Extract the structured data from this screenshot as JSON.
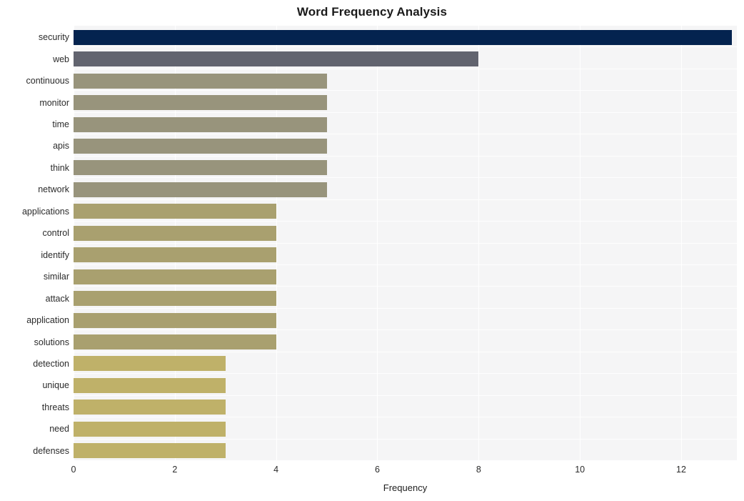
{
  "chart_data": {
    "type": "bar",
    "orientation": "horizontal",
    "title": "Word Frequency Analysis",
    "xlabel": "Frequency",
    "ylabel": "",
    "categories": [
      "security",
      "web",
      "continuous",
      "monitor",
      "time",
      "apis",
      "think",
      "network",
      "applications",
      "control",
      "identify",
      "similar",
      "attack",
      "application",
      "solutions",
      "detection",
      "unique",
      "threats",
      "need",
      "defenses"
    ],
    "values": [
      13,
      8,
      5,
      5,
      5,
      5,
      5,
      5,
      4,
      4,
      4,
      4,
      4,
      4,
      4,
      3,
      3,
      3,
      3,
      3
    ],
    "bar_colors": [
      "#04234f",
      "#62646f",
      "#98947c",
      "#98947c",
      "#98947c",
      "#98947c",
      "#98947c",
      "#98947c",
      "#a9a06f",
      "#a9a06f",
      "#a9a06f",
      "#a9a06f",
      "#a9a06f",
      "#a9a06f",
      "#a9a06f",
      "#bfb169",
      "#bfb169",
      "#bfb169",
      "#bfb169",
      "#bfb169"
    ],
    "xticks": [
      0,
      2,
      4,
      6,
      8,
      10,
      12
    ],
    "xtick_labels": [
      "0",
      "2",
      "4",
      "6",
      "8",
      "10",
      "12"
    ],
    "xlim": [
      0,
      13.1
    ],
    "grid": true,
    "legend": false,
    "plot_background": "#f5f5f6",
    "gridline_color": "#ffffff",
    "title_color": "#1a1a1a",
    "tick_label_color": "#2b2b2b"
  }
}
